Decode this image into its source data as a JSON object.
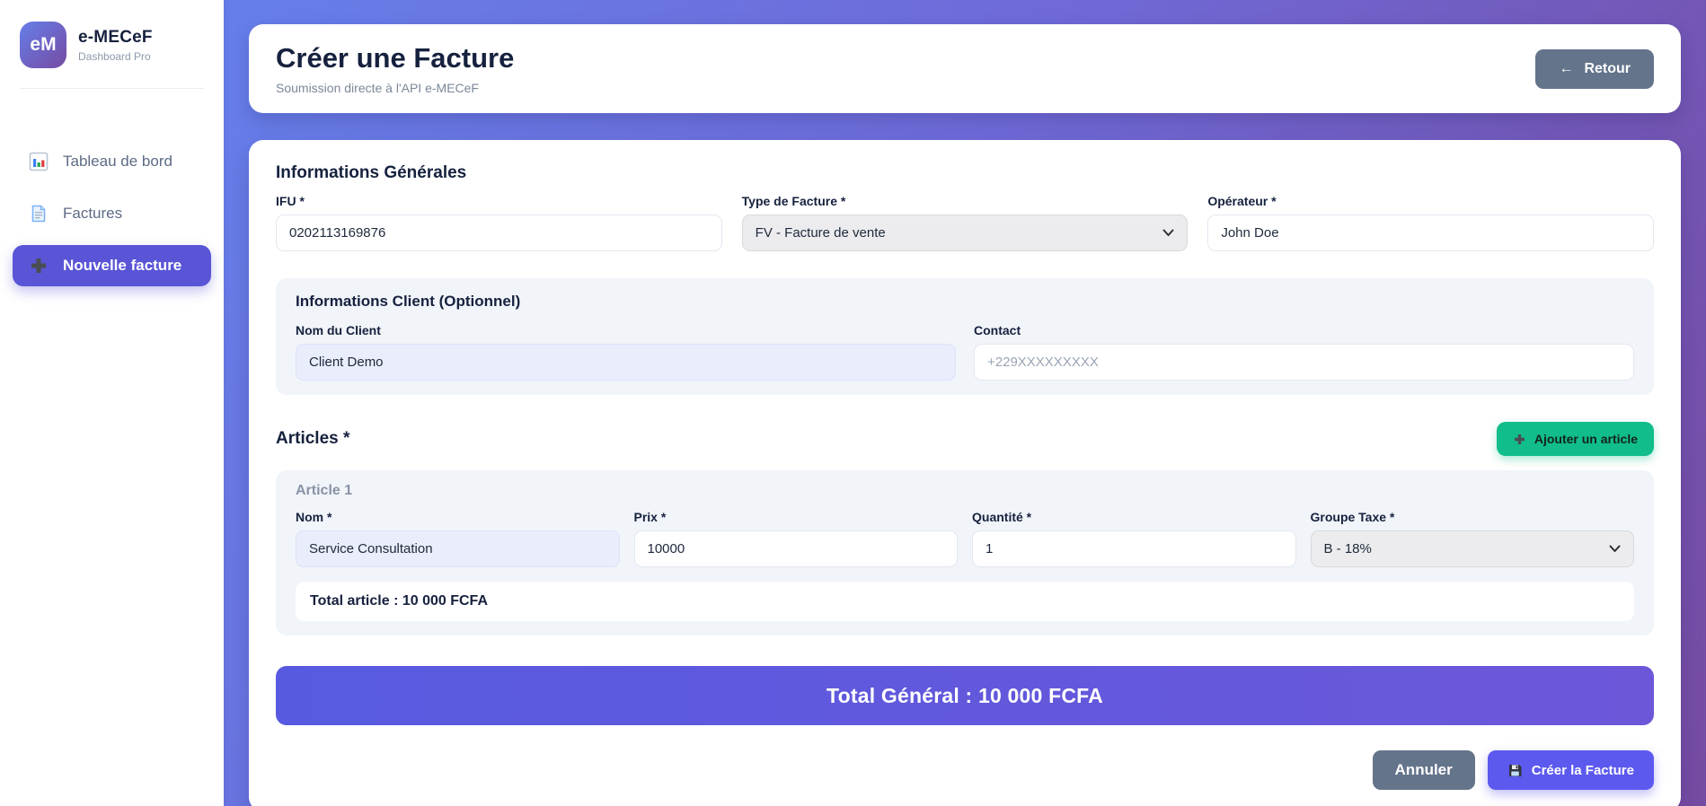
{
  "sidebar": {
    "logo_text": "eM",
    "title": "e-MECeF",
    "subtitle": "Dashboard Pro",
    "items": [
      {
        "label": "Tableau de bord"
      },
      {
        "label": "Factures"
      },
      {
        "label": "Nouvelle facture"
      }
    ]
  },
  "header": {
    "title": "Créer une Facture",
    "subtitle": "Soumission directe à l'API e-MECeF",
    "back_icon": "←",
    "back_label": "Retour"
  },
  "form": {
    "general": {
      "heading": "Informations Générales",
      "ifu": {
        "label": "IFU *",
        "value": "0202113169876"
      },
      "invoice_type": {
        "label": "Type de Facture *",
        "value": "FV - Facture de vente"
      },
      "operator": {
        "label": "Opérateur *",
        "value": "John Doe"
      }
    },
    "client": {
      "heading": "Informations Client (Optionnel)",
      "name": {
        "label": "Nom du Client",
        "value": "Client Demo"
      },
      "contact": {
        "label": "Contact",
        "placeholder": "+229XXXXXXXXX"
      }
    },
    "articles": {
      "heading": "Articles *",
      "add_button": "Ajouter un article",
      "items": [
        {
          "title": "Article 1",
          "name": {
            "label": "Nom *",
            "value": "Service Consultation"
          },
          "price": {
            "label": "Prix *",
            "value": "10000"
          },
          "quantity": {
            "label": "Quantité *",
            "value": "1"
          },
          "tax_group": {
            "label": "Groupe Taxe *",
            "value": "B - 18%"
          },
          "total": "Total article : 10 000 FCFA"
        }
      ]
    },
    "total_general": "Total Général : 10 000 FCFA",
    "actions": {
      "cancel": "Annuler",
      "submit": "Créer la Facture"
    }
  },
  "colors": {
    "gradient_start": "#667eea",
    "gradient_end": "#764ba2",
    "sidebar_active": "#5955d6",
    "slate_button": "#64748b",
    "green_button": "#10bd8b",
    "submit_button": "#5c59ee",
    "prefilled_input": "#e9edfc"
  }
}
